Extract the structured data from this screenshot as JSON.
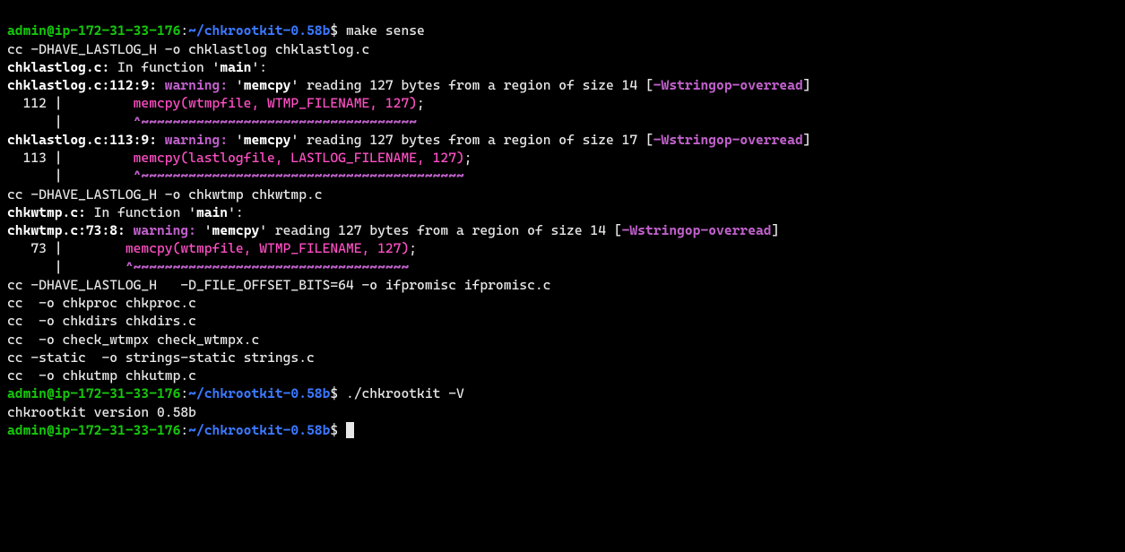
{
  "prompt": {
    "user": "admin",
    "host": "ip-172-31-33-176",
    "sep1": "@",
    "sep2": ":",
    "path": "~/chkrootkit-0.58b",
    "sigil": "$"
  },
  "colors": {
    "green": "#16c60c",
    "blue": "#3b78ff",
    "cyan": "#61d6d6",
    "white": "#e8e8e8",
    "magenta": "#d85bd8",
    "pink": "#ff4fc5"
  },
  "lines": [
    {
      "type": "prompt",
      "cmd": "make sense"
    },
    {
      "type": "plain",
      "text": "cc -DHAVE_LASTLOG_H -o chklastlog chklastlog.c"
    },
    {
      "type": "mixed",
      "spans": [
        {
          "cls": "bwhite",
          "text": "chklastlog.c:"
        },
        {
          "cls": "white",
          "text": " In function '"
        },
        {
          "cls": "bwhite",
          "text": "main"
        },
        {
          "cls": "white",
          "text": "':"
        }
      ]
    },
    {
      "type": "mixed",
      "spans": [
        {
          "cls": "bwhite",
          "text": "chklastlog.c:112:9:"
        },
        {
          "cls": "white",
          "text": " "
        },
        {
          "cls": "bmag",
          "text": "warning: "
        },
        {
          "cls": "white",
          "text": "'"
        },
        {
          "cls": "bwhite",
          "text": "memcpy"
        },
        {
          "cls": "white",
          "text": "' reading 127 bytes from a region of size 14 ["
        },
        {
          "cls": "bmag",
          "text": "-Wstringop-overread"
        },
        {
          "cls": "white",
          "text": "]"
        }
      ]
    },
    {
      "type": "mixed",
      "spans": [
        {
          "cls": "white",
          "text": "  112 |         "
        },
        {
          "cls": "pink",
          "text": "memcpy(wtmpfile, WTMP_FILENAME, 127)"
        },
        {
          "cls": "white",
          "text": ";"
        }
      ]
    },
    {
      "type": "mixed",
      "spans": [
        {
          "cls": "white",
          "text": "      |         "
        },
        {
          "cls": "bmag",
          "text": "^~~~~~~~~~~~~~~~~~~~~~~~~~~~~~~~~~~~"
        }
      ]
    },
    {
      "type": "mixed",
      "spans": [
        {
          "cls": "bwhite",
          "text": "chklastlog.c:113:9:"
        },
        {
          "cls": "white",
          "text": " "
        },
        {
          "cls": "bmag",
          "text": "warning: "
        },
        {
          "cls": "white",
          "text": "'"
        },
        {
          "cls": "bwhite",
          "text": "memcpy"
        },
        {
          "cls": "white",
          "text": "' reading 127 bytes from a region of size 17 ["
        },
        {
          "cls": "bmag",
          "text": "-Wstringop-overread"
        },
        {
          "cls": "white",
          "text": "]"
        }
      ]
    },
    {
      "type": "mixed",
      "spans": [
        {
          "cls": "white",
          "text": "  113 |         "
        },
        {
          "cls": "pink",
          "text": "memcpy(lastlogfile, LASTLOG_FILENAME, 127)"
        },
        {
          "cls": "white",
          "text": ";"
        }
      ]
    },
    {
      "type": "mixed",
      "spans": [
        {
          "cls": "white",
          "text": "      |         "
        },
        {
          "cls": "bmag",
          "text": "^~~~~~~~~~~~~~~~~~~~~~~~~~~~~~~~~~~~~~~~~~"
        }
      ]
    },
    {
      "type": "plain",
      "text": "cc -DHAVE_LASTLOG_H -o chkwtmp chkwtmp.c"
    },
    {
      "type": "mixed",
      "spans": [
        {
          "cls": "bwhite",
          "text": "chkwtmp.c:"
        },
        {
          "cls": "white",
          "text": " In function '"
        },
        {
          "cls": "bwhite",
          "text": "main"
        },
        {
          "cls": "white",
          "text": "':"
        }
      ]
    },
    {
      "type": "mixed",
      "spans": [
        {
          "cls": "bwhite",
          "text": "chkwtmp.c:73:8:"
        },
        {
          "cls": "white",
          "text": " "
        },
        {
          "cls": "bmag",
          "text": "warning: "
        },
        {
          "cls": "white",
          "text": "'"
        },
        {
          "cls": "bwhite",
          "text": "memcpy"
        },
        {
          "cls": "white",
          "text": "' reading 127 bytes from a region of size 14 ["
        },
        {
          "cls": "bmag",
          "text": "-Wstringop-overread"
        },
        {
          "cls": "white",
          "text": "]"
        }
      ]
    },
    {
      "type": "mixed",
      "spans": [
        {
          "cls": "white",
          "text": "   73 |        "
        },
        {
          "cls": "pink",
          "text": "memcpy(wtmpfile, WTMP_FILENAME, 127)"
        },
        {
          "cls": "white",
          "text": ";"
        }
      ]
    },
    {
      "type": "mixed",
      "spans": [
        {
          "cls": "white",
          "text": "      |        "
        },
        {
          "cls": "bmag",
          "text": "^~~~~~~~~~~~~~~~~~~~~~~~~~~~~~~~~~~~"
        }
      ]
    },
    {
      "type": "plain",
      "text": "cc -DHAVE_LASTLOG_H   -D_FILE_OFFSET_BITS=64 -o ifpromisc ifpromisc.c"
    },
    {
      "type": "plain",
      "text": "cc  -o chkproc chkproc.c"
    },
    {
      "type": "plain",
      "text": "cc  -o chkdirs chkdirs.c"
    },
    {
      "type": "plain",
      "text": "cc  -o check_wtmpx check_wtmpx.c"
    },
    {
      "type": "plain",
      "text": "cc -static  -o strings-static strings.c"
    },
    {
      "type": "plain",
      "text": "cc  -o chkutmp chkutmp.c"
    },
    {
      "type": "prompt",
      "cmd": "./chkrootkit -V"
    },
    {
      "type": "plain",
      "text": "chkrootkit version 0.58b"
    },
    {
      "type": "prompt",
      "cmd": "",
      "cursor": true
    }
  ]
}
